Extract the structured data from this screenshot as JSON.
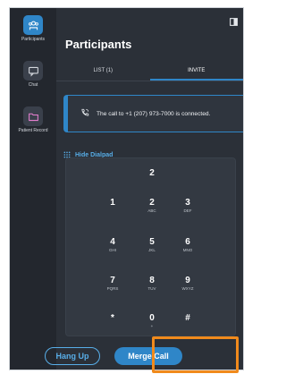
{
  "rail": {
    "items": [
      {
        "label": "Participants",
        "icon": "participants-icon",
        "active": true
      },
      {
        "label": "Chat",
        "icon": "chat-icon",
        "active": false
      },
      {
        "label": "Patient Record",
        "icon": "folder-icon",
        "active": false
      }
    ]
  },
  "panel": {
    "title": "Participants",
    "tabs": [
      {
        "label": "LIST (1)",
        "active": false
      },
      {
        "label": "INVITE",
        "active": true
      }
    ]
  },
  "banner": {
    "text": "The call to +1 (207) 973-7000 is connected.",
    "icon": "phone-connected-icon"
  },
  "dialpad": {
    "toggle_label": "Hide Dialpad",
    "display": "2",
    "keys": [
      {
        "num": "1",
        "sub": ""
      },
      {
        "num": "2",
        "sub": "ABC"
      },
      {
        "num": "3",
        "sub": "DEF"
      },
      {
        "num": "4",
        "sub": "GHI"
      },
      {
        "num": "5",
        "sub": "JKL"
      },
      {
        "num": "6",
        "sub": "MNO"
      },
      {
        "num": "7",
        "sub": "PQRS"
      },
      {
        "num": "8",
        "sub": "TUV"
      },
      {
        "num": "9",
        "sub": "WXYZ"
      },
      {
        "num": "*",
        "sub": ""
      },
      {
        "num": "0",
        "sub": "+"
      },
      {
        "num": "#",
        "sub": ""
      }
    ]
  },
  "actions": {
    "hang_up": "Hang Up",
    "merge_call": "Merge Call"
  },
  "colors": {
    "accent": "#2f86c8",
    "link": "#58aee8",
    "highlight": "#f08a1c",
    "background": "#2b3038"
  }
}
